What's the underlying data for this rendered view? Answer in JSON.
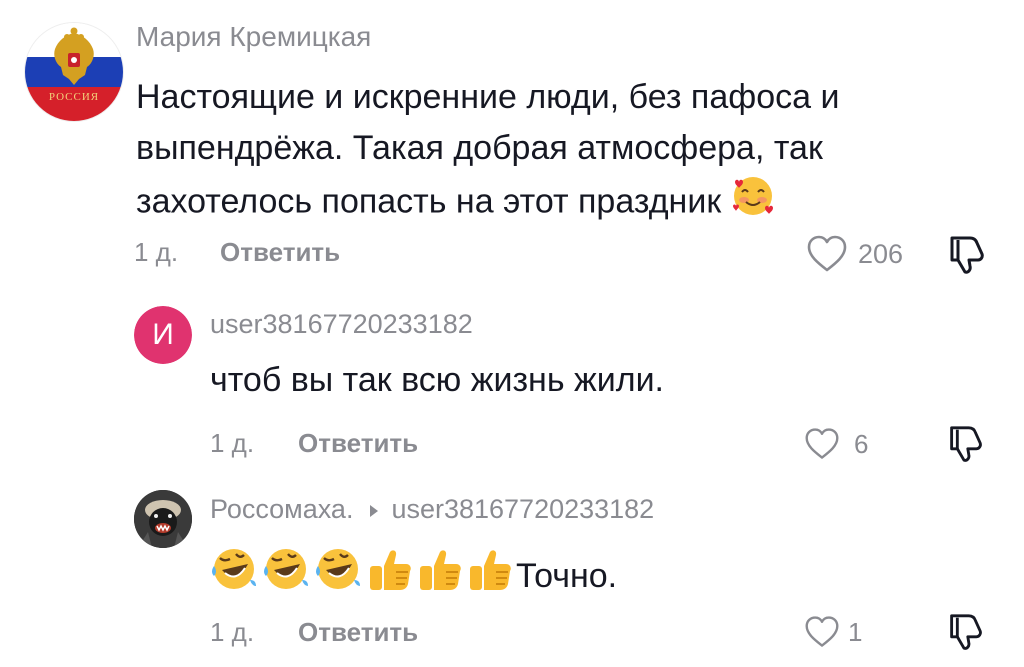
{
  "comments": [
    {
      "username": "Мария Кремицкая",
      "avatar_text": "РОССИЯ",
      "text": "Настоящие и искренние люди, без пафоса и выпендрёжа. Такая добрая атмосфера, так захотелось попасть на этот праздник",
      "emoji": "smiling-face-with-hearts",
      "time": "1 д.",
      "reply_label": "Ответить",
      "likes": "206"
    },
    {
      "username": "user38167720233182",
      "avatar_letter": "И",
      "avatar_color": "#e0336f",
      "text": "чтоб вы так всю жизнь жили.",
      "time": "1 д.",
      "reply_label": "Ответить",
      "likes": "6"
    },
    {
      "username": "Россомаха.",
      "reply_to": "user38167720233182",
      "text_suffix": "Точно.",
      "emojis": [
        "rolling-on-floor-laughing",
        "rolling-on-floor-laughing",
        "rolling-on-floor-laughing",
        "thumbs-up",
        "thumbs-up",
        "thumbs-up"
      ],
      "time": "1 д.",
      "reply_label": "Ответить",
      "likes": "1"
    }
  ],
  "colors": {
    "text": "#161823",
    "muted": "#8a8b91",
    "accent": "#e0336f"
  }
}
